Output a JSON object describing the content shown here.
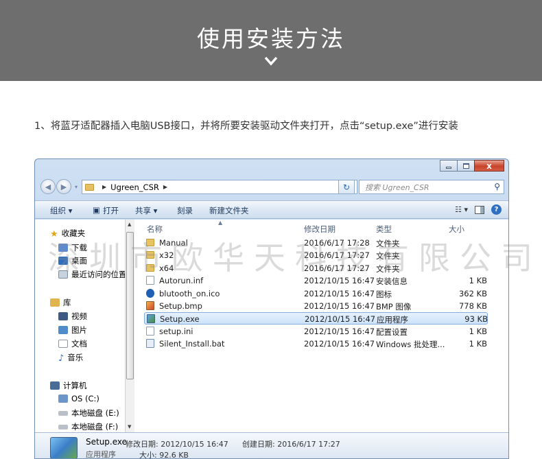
{
  "banner": {
    "title": "使用安装方法",
    "chevron_icon": "chevron-down-icon"
  },
  "instruction": "1、将蓝牙适配器插入电脑USB接口，并将所要安装驱动文件夹打开，点击“setup.exe”进行安装",
  "window": {
    "caption": {
      "minimize": "minimize-icon",
      "maximize": "maximize-icon",
      "close": "x"
    },
    "address": {
      "path_label": "Ugreen_CSR"
    },
    "search": {
      "placeholder": "搜索 Ugreen_CSR"
    },
    "toolbar": {
      "organize": "组织 ▾",
      "open": "打开",
      "share": "共享 ▾",
      "burn": "刻录",
      "new_folder": "新建文件夹"
    },
    "nav": {
      "favorites": "收藏夹",
      "downloads": "下载",
      "desktop": "桌面",
      "recent": "最近访问的位置",
      "libraries": "库",
      "videos": "视频",
      "pictures": "图片",
      "documents": "文档",
      "music": "音乐",
      "computer": "计算机",
      "os": "OS (C:)",
      "disk_e": "本地磁盘 (E:)",
      "disk_f": "本地磁盘 (F:)"
    },
    "columns": {
      "name": "名称",
      "date": "修改日期",
      "type": "类型",
      "size": "大小"
    },
    "files": [
      {
        "name": "Manual",
        "date": "2016/6/17 17:28",
        "type": "文件夹",
        "size": "",
        "icon": "folder"
      },
      {
        "name": "x32",
        "date": "2016/6/17 17:27",
        "type": "文件夹",
        "size": "",
        "icon": "folder"
      },
      {
        "name": "x64",
        "date": "2016/6/17 17:27",
        "type": "文件夹",
        "size": "",
        "icon": "folder"
      },
      {
        "name": "Autorun.inf",
        "date": "2012/10/15 16:47",
        "type": "安装信息",
        "size": "1 KB",
        "icon": "doc"
      },
      {
        "name": "blutooth_on.ico",
        "date": "2012/10/15 16:47",
        "type": "图标",
        "size": "362 KB",
        "icon": "bt"
      },
      {
        "name": "Setup.bmp",
        "date": "2012/10/15 16:47",
        "type": "BMP 图像",
        "size": "778 KB",
        "icon": "bmp"
      },
      {
        "name": "Setup.exe",
        "date": "2012/10/15 16:47",
        "type": "应用程序",
        "size": "93 KB",
        "icon": "exe",
        "selected": true
      },
      {
        "name": "setup.ini",
        "date": "2012/10/15 16:47",
        "type": "配置设置",
        "size": "1 KB",
        "icon": "doc"
      },
      {
        "name": "Silent_Install.bat",
        "date": "2012/10/15 16:47",
        "type": "Windows 批处理...",
        "size": "1 KB",
        "icon": "bat"
      }
    ],
    "details": {
      "filename": "Setup.exe",
      "type": "应用程序",
      "modified": "修改日期: 2012/10/15 16:47",
      "created": "创建日期: 2016/6/17 17:27",
      "size": "大小: 92.6 KB"
    }
  },
  "watermark": "深圳市欧华天科技有限公司"
}
